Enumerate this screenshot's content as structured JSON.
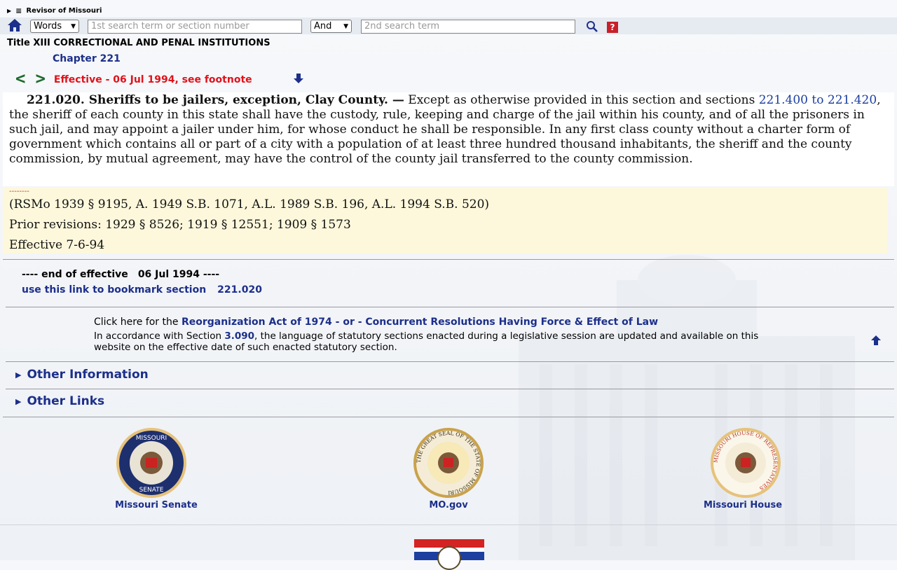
{
  "header": {
    "site_title": "Revisor of Missouri"
  },
  "search": {
    "mode_value": "Words",
    "term1_placeholder": "1st search term or section number",
    "operator_value": "And",
    "term2_placeholder": "2nd search term",
    "help_label": "?"
  },
  "breadcrumb": {
    "title": "Title XIII CORRECTIONAL AND PENAL INSTITUTIONS",
    "chapter": "Chapter 221"
  },
  "nav": {
    "prev": "<",
    "next": ">",
    "effective": "Effective - 06 Jul 1994, see footnote"
  },
  "section": {
    "heading": "221.020. Sheriffs to be jailers, exception, Clay County. —",
    "text_intro": " Except as otherwise provided in this section and sections ",
    "link_text": "221.400 to 221.420",
    "text_rest": ", the sheriff of each county in this state shall have the custody, rule, keeping and charge of the jail within his county, and of all the prisoners in such jail, and may appoint a jailer under him, for whose conduct he shall be responsible.  In any first class county without a charter form of government which contains all or part of a city with a population of at least three hundred thousand inhabitants, the sheriff and the county commission, by mutual agreement, may have the control of the county jail transferred to the county commission."
  },
  "notes": {
    "dashes": "--------",
    "history": "(RSMo 1939 § 9195, A. 1949 S.B. 1071, A.L. 1989 S.B. 196, A.L. 1994 S.B. 520)",
    "prior": "Prior revisions: 1929 § 8526; 1919 § 12551; 1909 § 1573",
    "effective": "Effective 7-6-94"
  },
  "end": {
    "label": "---- end of effective",
    "date": "06 Jul 1994 ----",
    "bookmark_label": "use this link to bookmark section",
    "bookmark_num": "221.020"
  },
  "reorg": {
    "prefix": "Click here for the ",
    "link": "Reorganization Act of 1974 - or - Concurrent Resolutions Having Force & Effect of Law",
    "accord_prefix": "In accordance with Section ",
    "accord_section": "3.090",
    "accord_rest": ", the language of statutory sections enacted during a legislative session are updated and available on this website on the effective date of such enacted statutory section."
  },
  "expanders": {
    "other_info": "Other Information",
    "other_links": "Other Links"
  },
  "footer": {
    "senate": "Missouri Senate",
    "mogov": "MO.gov",
    "house": "Missouri House",
    "senate_seal_top": "MISSOURI",
    "senate_seal_bottom": "SENATE",
    "state_seal_ring": "THE GREAT SEAL OF THE STATE OF MISSOURI",
    "house_seal_ring": "MISSOURI HOUSE OF REPRESENTATIVES"
  },
  "colors": {
    "link_blue": "#1c2f8a",
    "effective_red": "#e0121c",
    "note_bg": "#fdf8dc",
    "nav_green": "#1d6b2f"
  }
}
